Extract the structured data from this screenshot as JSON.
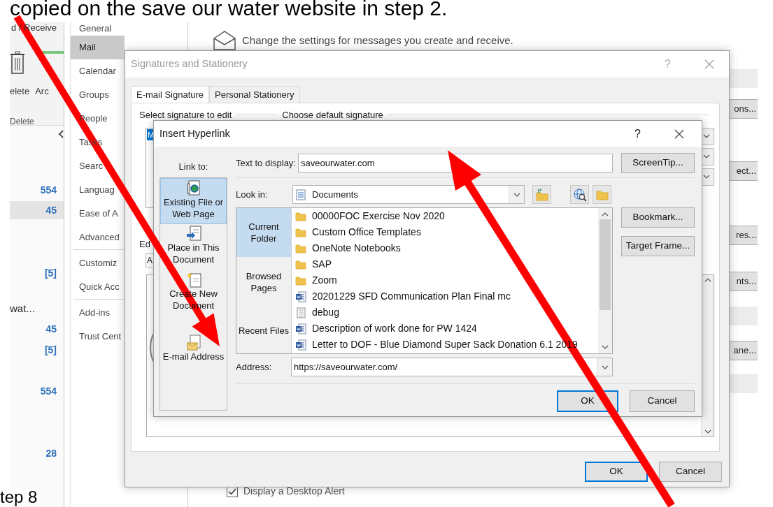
{
  "document_text": {
    "top": "copied on the save our water website in step 2.",
    "bottom": "tep 8"
  },
  "mail_pane": {
    "ribbon_fragment": "d / Receive",
    "ribbon_buttons": [
      "elete",
      "Arc"
    ],
    "group_label": "Delete",
    "folder_rows": [
      {
        "text": "554",
        "kind": "count",
        "selected": false
      },
      {
        "text": "45",
        "kind": "count",
        "selected": true
      },
      {
        "text": "[5]",
        "kind": "count",
        "selected": false
      },
      {
        "text": "wat...",
        "kind": "name",
        "selected": false
      },
      {
        "text": "45",
        "kind": "count",
        "selected": false
      },
      {
        "text": "[5]",
        "kind": "count",
        "selected": false
      },
      {
        "text": "554",
        "kind": "count",
        "selected": false
      },
      {
        "text": "28",
        "kind": "count",
        "selected": false
      }
    ]
  },
  "options_nav": {
    "groups": [
      [
        {
          "label": "General",
          "selected": false
        },
        {
          "label": "Mail",
          "selected": true
        },
        {
          "label": "Calendar",
          "selected": false
        },
        {
          "label": "Groups",
          "selected": false
        },
        {
          "label": "People",
          "selected": false
        },
        {
          "label": "Tasks",
          "selected": false
        },
        {
          "label": "Searc",
          "selected": false
        },
        {
          "label": "Languag",
          "selected": false
        },
        {
          "label": "Ease of A",
          "selected": false
        },
        {
          "label": "Advanced",
          "selected": false
        }
      ],
      [
        {
          "label": "Customiz",
          "selected": false
        },
        {
          "label": "Quick Acc",
          "selected": false
        }
      ],
      [
        {
          "label": "Add-ins",
          "selected": false
        },
        {
          "label": "Trust Cent",
          "selected": false
        }
      ]
    ]
  },
  "options_content": {
    "description": "Change the settings for messages you create and receive.",
    "right_fragments": [
      {
        "kind": "band"
      },
      {
        "kind": "button",
        "text": "ons..."
      },
      {
        "kind": "button",
        "text": "ect..."
      },
      {
        "kind": "button",
        "text": "res..."
      },
      {
        "kind": "button",
        "text": "nts..."
      },
      {
        "kind": "band"
      },
      {
        "kind": "button",
        "text": "ane..."
      },
      {
        "kind": "band"
      }
    ],
    "desktop_alert": {
      "label": "Display a Desktop Alert",
      "checked": true
    }
  },
  "signatures_dialog": {
    "title": "Signatures and Stationery",
    "help": "?",
    "tabs": [
      {
        "label": "E-mail Signature",
        "selected": true
      },
      {
        "label": "Personal Stationery",
        "selected": false
      }
    ],
    "select_label": "Select signature to edit",
    "default_label": "Choose default signature",
    "signature_item": {
      "text": "M",
      "selected": true
    },
    "edit_label": "Ed",
    "font_box": "A",
    "buttons": [
      {
        "label": "OK",
        "default": true
      },
      {
        "label": "Cancel",
        "default": false
      }
    ]
  },
  "hyperlink_dialog": {
    "title": "Insert Hyperlink",
    "help": "?",
    "link_to_label": "Link to:",
    "link_options": [
      {
        "label": "Existing File or Web Page",
        "selected": true,
        "kind": "file"
      },
      {
        "label": "Place in This Document",
        "selected": false,
        "kind": "place"
      },
      {
        "label": "Create New Document",
        "selected": false,
        "kind": "new"
      },
      {
        "label": "E-mail Address",
        "selected": false,
        "kind": "email"
      }
    ],
    "text_to_display": {
      "label": "Text to display:",
      "value": "saveourwater.com"
    },
    "screentip_button": "ScreenTip...",
    "look_in": {
      "label": "Look in:",
      "value": "Documents"
    },
    "browse_options": [
      {
        "label": "Current Folder",
        "selected": true
      },
      {
        "label": "Browsed Pages",
        "selected": false
      },
      {
        "label": "Recent Files",
        "selected": false
      }
    ],
    "files": [
      {
        "name": "00000FOC Exercise Nov 2020",
        "kind": "folder"
      },
      {
        "name": "Custom Office Templates",
        "kind": "folder"
      },
      {
        "name": "OneNote Notebooks",
        "kind": "folder"
      },
      {
        "name": "SAP",
        "kind": "folder"
      },
      {
        "name": "Zoom",
        "kind": "folder"
      },
      {
        "name": "20201229 SFD Communication Plan Final mc",
        "kind": "word"
      },
      {
        "name": "debug",
        "kind": "text"
      },
      {
        "name": "Description of work done for PW 1424",
        "kind": "word"
      },
      {
        "name": "Letter to DOF - Blue Diamond Super Sack Donation 6.1 2019",
        "kind": "word"
      }
    ],
    "side_buttons": [
      "Bookmark...",
      "Target Frame..."
    ],
    "address": {
      "label": "Address:",
      "value": "https://saveourwater.com/"
    },
    "buttons": [
      {
        "label": "OK",
        "default": true
      },
      {
        "label": "Cancel",
        "default": false
      }
    ]
  }
}
